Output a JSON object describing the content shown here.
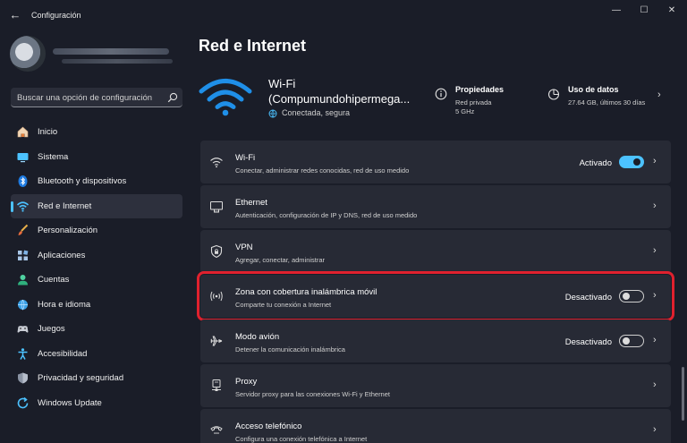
{
  "window": {
    "title": "Configuración",
    "back_glyph": "←",
    "min_glyph": "—",
    "max_glyph": "☐",
    "close_glyph": "✕"
  },
  "search": {
    "placeholder": "Buscar una opción de configuración",
    "icon": "search-icon"
  },
  "sidebar": {
    "items": [
      {
        "label": "Inicio",
        "icon": "home-icon",
        "active": false
      },
      {
        "label": "Sistema",
        "icon": "system-icon",
        "active": false
      },
      {
        "label": "Bluetooth y dispositivos",
        "icon": "bluetooth-icon",
        "active": false
      },
      {
        "label": "Red e Internet",
        "icon": "network-icon",
        "active": true
      },
      {
        "label": "Personalización",
        "icon": "brush-icon",
        "active": false
      },
      {
        "label": "Aplicaciones",
        "icon": "apps-icon",
        "active": false
      },
      {
        "label": "Cuentas",
        "icon": "account-icon",
        "active": false
      },
      {
        "label": "Hora e idioma",
        "icon": "globe-clock-icon",
        "active": false
      },
      {
        "label": "Juegos",
        "icon": "gamepad-icon",
        "active": false
      },
      {
        "label": "Accesibilidad",
        "icon": "accessibility-icon",
        "active": false
      },
      {
        "label": "Privacidad y seguridad",
        "icon": "shield-icon",
        "active": false
      },
      {
        "label": "Windows Update",
        "icon": "update-icon",
        "active": false
      }
    ]
  },
  "main": {
    "title": "Red e Internet",
    "hero": {
      "name": "Wi-Fi (Compumundohipermega...",
      "status": "Conectada, segura",
      "properties": {
        "title": "Propiedades",
        "lines": [
          "Red privada",
          "5 GHz"
        ]
      },
      "data_usage": {
        "title": "Uso de datos",
        "line": "27.64 GB, últimos 30 días"
      }
    },
    "rows": [
      {
        "title": "Wi-Fi",
        "subtitle": "Conectar, administrar redes conocidas, red de uso medido",
        "status": "Activado",
        "toggle": "on",
        "icon": "wifi-icon"
      },
      {
        "title": "Ethernet",
        "subtitle": "Autenticación, configuración de IP y DNS, red de uso medido",
        "status": "",
        "toggle": "",
        "icon": "ethernet-icon"
      },
      {
        "title": "VPN",
        "subtitle": "Agregar, conectar, administrar",
        "status": "",
        "toggle": "",
        "icon": "vpn-shield-icon"
      },
      {
        "title": "Zona con cobertura inalámbrica móvil",
        "subtitle": "Comparte tu conexión a Internet",
        "status": "Desactivado",
        "toggle": "off",
        "icon": "hotspot-icon",
        "highlighted": true
      },
      {
        "title": "Modo avión",
        "subtitle": "Detener la comunicación inalámbrica",
        "status": "Desactivado",
        "toggle": "off",
        "icon": "airplane-icon"
      },
      {
        "title": "Proxy",
        "subtitle": "Servidor proxy para las conexiones Wi-Fi y Ethernet",
        "status": "",
        "toggle": "",
        "icon": "proxy-icon"
      },
      {
        "title": "Acceso telefónico",
        "subtitle": "Configura una conexión telefónica a Internet",
        "status": "",
        "toggle": "",
        "icon": "dialup-icon"
      }
    ]
  },
  "colors": {
    "accent": "#4cc2ff",
    "highlight": "#e0212e",
    "background": "#1a1d28",
    "card": "#272a35"
  }
}
